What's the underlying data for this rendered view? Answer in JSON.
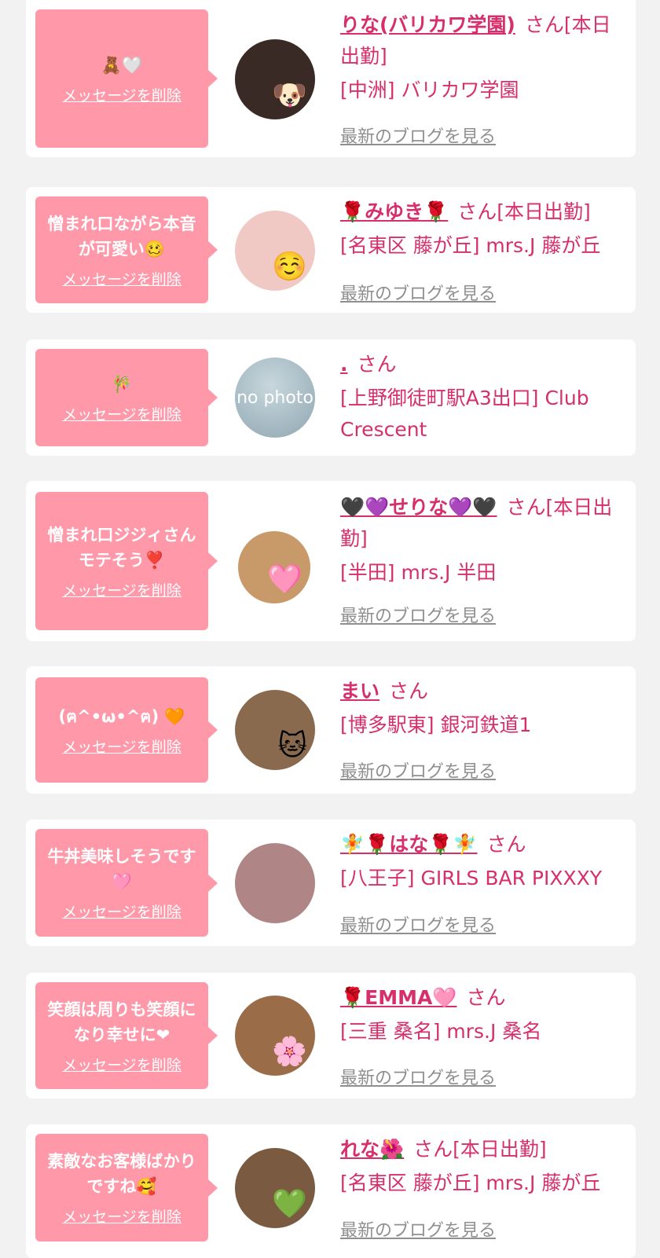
{
  "delete_label": "メッセージを削除",
  "blog_label": "最新のブログを見る",
  "entries": [
    {
      "message": "🧸🤍",
      "name": "りな(バリカワ学園)",
      "suffix": "さん[本日出勤]",
      "shop": "[中洲] バリカワ学園",
      "avatar_emoji": "🐶",
      "avatar_color": "#3a2a26"
    },
    {
      "message": "憎まれ口ながら本音が可愛い🥴",
      "name": "🌹みゆき🌹",
      "suffix": "さん[本日出勤]",
      "shop": "[名東区 藤が丘] mrs.J 藤が丘",
      "avatar_emoji": "☺️",
      "avatar_color": "#f1c9c4"
    },
    {
      "message": "🎋",
      "name": ".",
      "suffix": "さん",
      "shop": "[上野御徒町駅A3出口] Club Crescent",
      "avatar_text": "no photo"
    },
    {
      "message": "憎まれ口ジジィさんモテそう❣️",
      "name": "🖤💜せりな💜🖤",
      "suffix": "さん[本日出勤]",
      "shop": "[半田] mrs.J 半田",
      "avatar_emoji": "🩷",
      "avatar_color": "#c89a6a"
    },
    {
      "message": "(ฅ^•ω•^ฅ) 🧡",
      "name": "まい",
      "suffix": "さん",
      "shop": "[博多駅東] 銀河鉄道1",
      "avatar_emoji": "🐱",
      "avatar_color": "#8a6a4e"
    },
    {
      "message": "牛丼美味しそうです🩷",
      "name": "🧚🌹はな🌹🧚",
      "suffix": "さん",
      "shop": "[八王子] GIRLS BAR PIXXXY",
      "avatar_emoji": "",
      "avatar_color": "#b08585"
    },
    {
      "message": "笑顔は周りも笑顔になり幸せに❤",
      "name": "🌹EMMA🩷",
      "suffix": "さん",
      "shop": "[三重 桑名] mrs.J 桑名",
      "avatar_emoji": "🌸",
      "avatar_color": "#9a6c48"
    },
    {
      "message": "素敵なお客様ばかりですね🥰",
      "name": "れな🌺",
      "suffix": "さん[本日出勤]",
      "shop": "[名東区 藤が丘] mrs.J 藤が丘",
      "avatar_emoji": "💚",
      "avatar_color": "#7a5a40"
    }
  ],
  "colors": {
    "bubble": "#ff98a9",
    "accent": "#d62f6b",
    "link_gray": "#8f8f8f",
    "background": "#f2f2f2"
  }
}
